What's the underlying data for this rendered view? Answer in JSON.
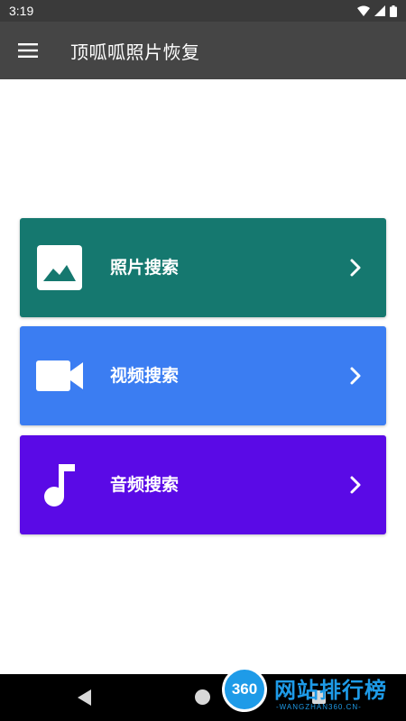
{
  "status_bar": {
    "time": "3:19"
  },
  "app_bar": {
    "title": "顶呱呱照片恢复"
  },
  "cards": [
    {
      "label": "照片搜索",
      "icon": "image-icon",
      "color": "#15786f"
    },
    {
      "label": "视频搜索",
      "icon": "videocam-icon",
      "color": "#3b7df2"
    },
    {
      "label": "音频搜索",
      "icon": "music-note-icon",
      "color": "#5a0ae6"
    }
  ],
  "watermark": {
    "logo_text": "360",
    "title": "网站排行榜",
    "subtitle": "-WANGZHAN360.CN-"
  }
}
